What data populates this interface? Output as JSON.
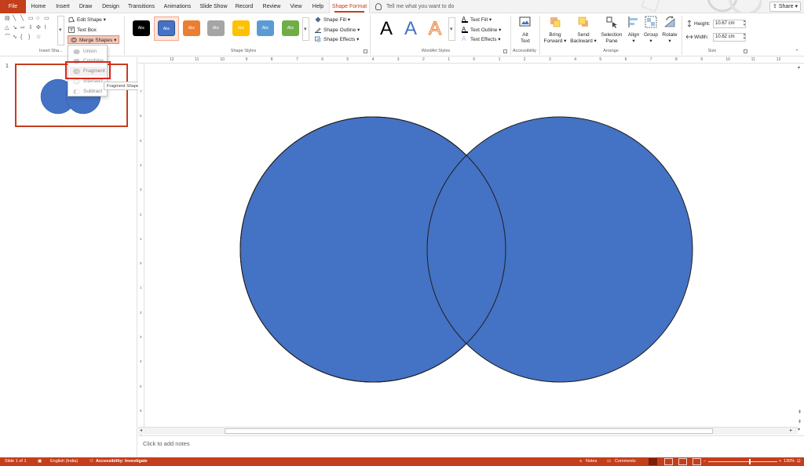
{
  "tabs": [
    {
      "label": "File"
    },
    {
      "label": "Home"
    },
    {
      "label": "Insert"
    },
    {
      "label": "Draw"
    },
    {
      "label": "Design"
    },
    {
      "label": "Transitions"
    },
    {
      "label": "Animations"
    },
    {
      "label": "Slide Show"
    },
    {
      "label": "Record"
    },
    {
      "label": "Review"
    },
    {
      "label": "View"
    },
    {
      "label": "Help"
    },
    {
      "label": "Shape Format"
    }
  ],
  "tell_me": "Tell me what you want to do",
  "share_label": "Share",
  "ribbon": {
    "insert_shapes": {
      "label": "Insert Sha...",
      "edit_shape": "Edit Shape",
      "text_box": "Text Box",
      "merge_shapes": "Merge Shapes"
    },
    "shape_styles": {
      "label": "Shape Styles",
      "swatch_text": "Abc",
      "swatch_colors": [
        "#000000",
        "#4472c4",
        "#ed7d31",
        "#a5a5a5",
        "#ffc000",
        "#5b9bd5",
        "#70ad47"
      ],
      "shape_fill": "Shape Fill",
      "shape_outline": "Shape Outline",
      "shape_effects": "Shape Effects"
    },
    "wordart": {
      "label": "WordArt Styles",
      "letter": "A",
      "text_fill": "Text Fill",
      "text_outline": "Text Outline",
      "text_effects": "Text Effects"
    },
    "accessibility": {
      "label": "Accessibility",
      "alt_text_1": "Alt",
      "alt_text_2": "Text"
    },
    "arrange": {
      "label": "Arrange",
      "bring_forward_1": "Bring",
      "bring_forward_2": "Forward",
      "send_backward_1": "Send",
      "send_backward_2": "Backward",
      "selection_pane_1": "Selection",
      "selection_pane_2": "Pane",
      "align": "Align",
      "group": "Group",
      "rotate": "Rotate"
    },
    "size": {
      "label": "Size",
      "height_label": "Height:",
      "height_value": "10.67 cm",
      "width_label": "Width:",
      "width_value": "10.62 cm"
    }
  },
  "merge_menu": {
    "items": [
      {
        "label": "Union"
      },
      {
        "label": "Combine"
      },
      {
        "label": "Fragment"
      },
      {
        "label": "Intersect"
      },
      {
        "label": "Subtract"
      }
    ],
    "tooltip": "Fragment Shapes"
  },
  "thumbnail": {
    "slide_number": "1"
  },
  "rulers": {
    "horizontal": [
      "12",
      "11",
      "10",
      "9",
      "8",
      "7",
      "6",
      "5",
      "4",
      "3",
      "2",
      "1",
      "0",
      "1",
      "2",
      "3",
      "4",
      "5",
      "6",
      "7",
      "8",
      "9",
      "10",
      "11",
      "12"
    ],
    "vertical": [
      "7",
      "6",
      "5",
      "4",
      "3",
      "2",
      "1",
      "0",
      "1",
      "2",
      "3",
      "4",
      "5",
      "6",
      "7"
    ]
  },
  "slide": {
    "circle_fill": "#4472c4",
    "circle_stroke": "#1f1f1f"
  },
  "notes_placeholder": "Click to add notes",
  "status": {
    "slide_info": "Slide 1 of 1",
    "language": "English (India)",
    "accessibility": "Accessibility: Investigate",
    "notes": "Notes",
    "comments": "Comments",
    "zoom": "130%"
  },
  "colors": {
    "accent": "#c43e1c",
    "shape_blue": "#4472c4"
  }
}
